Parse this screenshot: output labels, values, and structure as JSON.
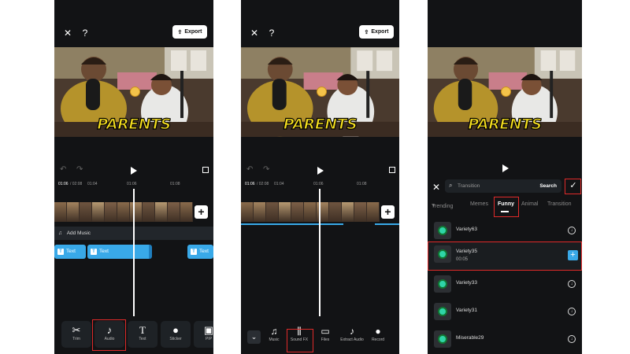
{
  "panels": {
    "panel1": {
      "export_label": "Export",
      "timecode": "01:06",
      "duration": "/ 02:08",
      "ruler_ticks": [
        "01:04",
        "01:06",
        "01:08"
      ],
      "add_music_label": "Add Music",
      "caption": "PARENTS",
      "text_clips": [
        "Text",
        "Text",
        "Text"
      ],
      "tools": [
        {
          "label": "Trim",
          "icon": "scissors-icon"
        },
        {
          "label": "Audio",
          "icon": "music-note-icon"
        },
        {
          "label": "Text",
          "icon": "text-icon"
        },
        {
          "label": "Sticker",
          "icon": "sticker-icon"
        },
        {
          "label": "PIP",
          "icon": "pip-icon"
        }
      ]
    },
    "panel2": {
      "export_label": "Export",
      "timecode": "01:06",
      "duration": "/ 02:08",
      "ruler_ticks": [
        "01:04",
        "01:06",
        "01:08"
      ],
      "caption": "PARENTS",
      "tools": [
        {
          "label": "Music",
          "icon": "music-icon"
        },
        {
          "label": "Sound FX",
          "icon": "sound-fx-icon"
        },
        {
          "label": "Files",
          "icon": "folder-icon"
        },
        {
          "label": "Extract Audio",
          "icon": "extract-audio-icon"
        },
        {
          "label": "Record",
          "icon": "microphone-icon"
        }
      ]
    },
    "panel3": {
      "caption": "PARENTS",
      "search_placeholder": "Transition",
      "search_button": "Search",
      "tabs": [
        "Trending",
        "Memes",
        "Funny",
        "Animal",
        "Transition"
      ],
      "active_tab": "Funny",
      "sounds": [
        {
          "name": "Variety63",
          "duration": ""
        },
        {
          "name": "Variety35",
          "duration": "00:05"
        },
        {
          "name": "Variety33",
          "duration": ""
        },
        {
          "name": "Variety31",
          "duration": ""
        },
        {
          "name": "Miserable29",
          "duration": ""
        }
      ]
    }
  },
  "colors": {
    "background": "#121315",
    "accent": "#39a9e8",
    "highlight": "#e02a2a",
    "caption": "#f6df1f"
  }
}
